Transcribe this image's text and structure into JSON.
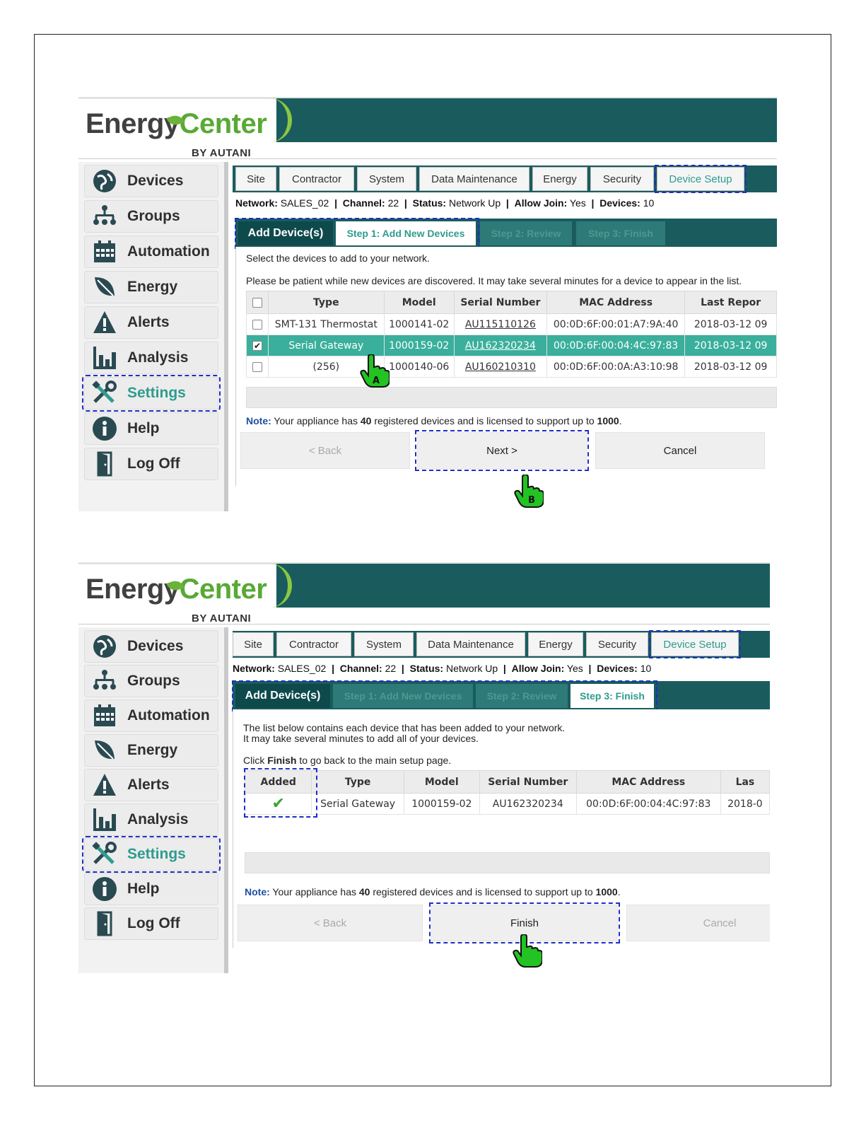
{
  "brand": {
    "part1": "Energy",
    "part2": "Center",
    "byline": "BY AUTANI"
  },
  "sidebar": {
    "items": [
      {
        "label": "Devices",
        "icon": "devices-globe-icon"
      },
      {
        "label": "Groups",
        "icon": "groups-tree-icon"
      },
      {
        "label": "Automation",
        "icon": "calendar-icon"
      },
      {
        "label": "Energy",
        "icon": "leaf-icon"
      },
      {
        "label": "Alerts",
        "icon": "warning-triangle-icon"
      },
      {
        "label": "Analysis",
        "icon": "bar-chart-icon"
      },
      {
        "label": "Settings",
        "icon": "tools-icon"
      },
      {
        "label": "Help",
        "icon": "info-icon"
      },
      {
        "label": "Log Off",
        "icon": "door-icon"
      }
    ]
  },
  "tabs": [
    "Site",
    "Contractor",
    "System",
    "Data Maintenance",
    "Energy",
    "Security",
    "Device Setup"
  ],
  "status": {
    "network_label": "Network:",
    "network": "SALES_02",
    "channel_label": "Channel:",
    "channel": "22",
    "status_label": "Status:",
    "status": "Network Up",
    "join_label": "Allow Join:",
    "join": "Yes",
    "devices_label": "Devices:",
    "devices": "10",
    "sep": "|"
  },
  "wizard": {
    "title": "Add Device(s)",
    "step1": "Step 1: Add New Devices",
    "step2": "Step 2: Review",
    "step3": "Step 3: Finish"
  },
  "screen1": {
    "msg1": "Select the devices to add to your network.",
    "msg2": "Please be patient while new devices are discovered. It may take several minutes for a device to appear in the list.",
    "columns": [
      "Type",
      "Model",
      "Serial Number",
      "MAC Address",
      "Last Repor"
    ],
    "rows": [
      {
        "type": "SMT-131 Thermostat",
        "model": "1000141-02",
        "serial": "AU115110126",
        "mac": "00:0D:6F:00:01:A7:9A:40",
        "last": "2018-03-12 09",
        "checked": false
      },
      {
        "type": "Serial Gateway",
        "model": "1000159-02",
        "serial": "AU162320234",
        "mac": "00:0D:6F:00:04:4C:97:83",
        "last": "2018-03-12 09",
        "checked": true
      },
      {
        "type": "(256)",
        "model": "1000140-06",
        "serial": "AU160210310",
        "mac": "00:0D:6F:00:0A:A3:10:98",
        "last": "2018-03-12 09",
        "checked": false
      }
    ],
    "buttons": {
      "back": "< Back",
      "next": "Next >",
      "cancel": "Cancel"
    },
    "markers": {
      "a": "A",
      "b": "B"
    }
  },
  "screen2": {
    "msg1": "The list below contains each device that has been added to your network.",
    "msg2": "It may take several minutes to add all of your devices.",
    "msg3_pre": "Click ",
    "msg3_bold": "Finish",
    "msg3_post": " to go back to the main setup page.",
    "columns": [
      "Added",
      "Type",
      "Model",
      "Serial Number",
      "MAC Address",
      "Las"
    ],
    "rows": [
      {
        "added": "✔",
        "type": "Serial Gateway",
        "model": "1000159-02",
        "serial": "AU162320234",
        "mac": "00:0D:6F:00:04:4C:97:83",
        "last": "2018-0"
      }
    ],
    "buttons": {
      "back": "< Back",
      "finish": "Finish",
      "cancel": "Cancel"
    }
  },
  "note": {
    "label": "Note:",
    "pre": " Your appliance has ",
    "count": "40",
    "mid": " registered devices and is licensed to support up to ",
    "limit": "1000",
    "post": "."
  },
  "colors": {
    "teal_dark": "#1a5c5e",
    "teal_accent": "#2e9c8e",
    "selected_row": "#3aaf9c",
    "highlight_dash": "#1e2ec4",
    "hand_green": "#22c322"
  }
}
